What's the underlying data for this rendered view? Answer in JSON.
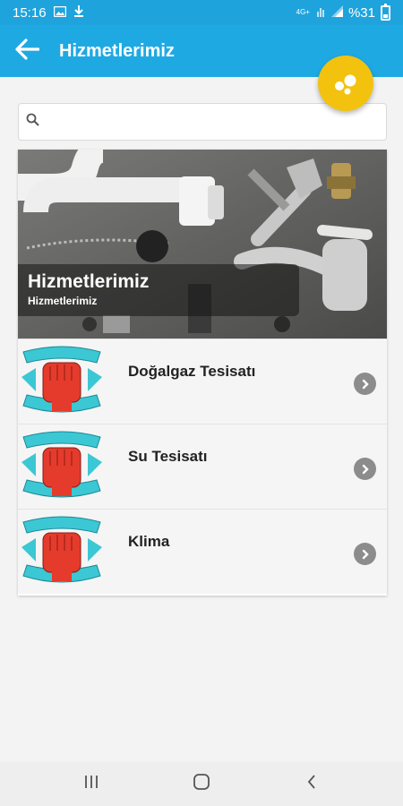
{
  "status_bar": {
    "time": "15:16",
    "battery_text": "%31",
    "network_label": "4G+"
  },
  "app_bar": {
    "title": "Hizmetlerimiz",
    "back_icon": "arrow-left-icon"
  },
  "fab": {
    "icon": "bubbles-icon",
    "color": "#f2c20f"
  },
  "search": {
    "placeholder": "",
    "value": ""
  },
  "hero": {
    "title": "Hizmetlerimiz",
    "subtitle": "Hizmetlerimiz"
  },
  "services": [
    {
      "name": "Doğalgaz Tesisatı"
    },
    {
      "name": "Su Tesisatı"
    },
    {
      "name": "Klima"
    }
  ],
  "colors": {
    "primary": "#1fa9e3",
    "status_bar": "#1fa3dd",
    "accent": "#f2c20f"
  }
}
